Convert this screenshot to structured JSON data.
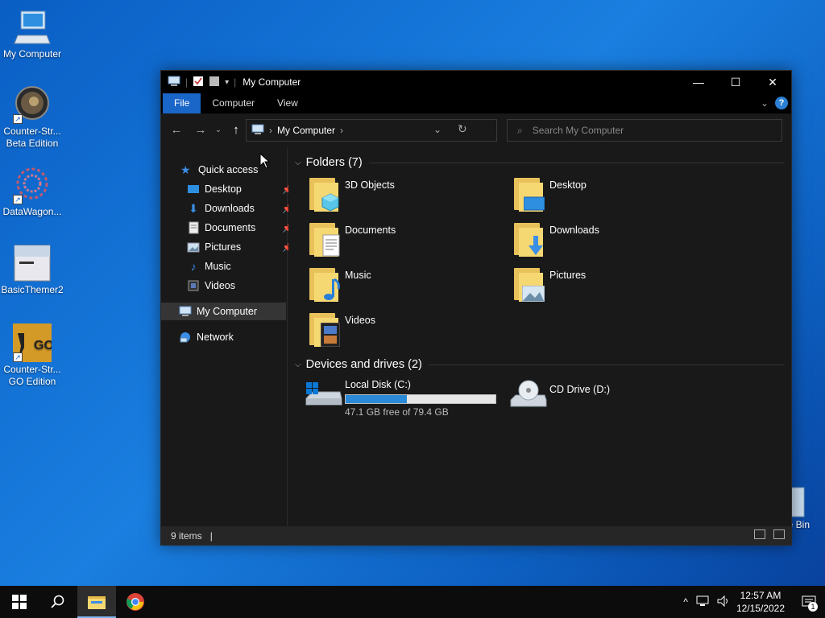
{
  "desktop": {
    "icons": [
      {
        "label": "My Computer",
        "icon": "computer-icon"
      },
      {
        "label": "Counter-Str... Beta Edition",
        "line1": "Counter-Str...",
        "line2": "Beta Edition",
        "icon": "cs-beta-icon"
      },
      {
        "label": "DataWagon...",
        "icon": "datawagon-icon"
      },
      {
        "label": "BasicThemer2",
        "icon": "window-icon"
      },
      {
        "label": "Counter-Str... GO Edition",
        "line1": "Counter-Str...",
        "line2": "GO Edition",
        "icon": "csgo-icon"
      },
      {
        "label": "e Bin",
        "icon": "recycle-bin-icon"
      }
    ]
  },
  "window": {
    "title": "My Computer",
    "ribbon_tabs": [
      "File",
      "Computer",
      "View"
    ],
    "address": {
      "root": "My Computer"
    },
    "search_placeholder": "Search My Computer",
    "sidebar": {
      "quick_access": "Quick access",
      "items": [
        {
          "label": "Desktop",
          "pinned": true
        },
        {
          "label": "Downloads",
          "pinned": true
        },
        {
          "label": "Documents",
          "pinned": true
        },
        {
          "label": "Pictures",
          "pinned": true
        },
        {
          "label": "Music",
          "pinned": false
        },
        {
          "label": "Videos",
          "pinned": false
        }
      ],
      "my_computer": "My Computer",
      "network": "Network"
    },
    "folders_header": "Folders (7)",
    "folders": [
      "3D Objects",
      "Desktop",
      "Documents",
      "Downloads",
      "Music",
      "Pictures",
      "Videos"
    ],
    "drives_header": "Devices and drives (2)",
    "drives": [
      {
        "name": "Local Disk (C:)",
        "free_text": "47.1 GB free of 79.4 GB",
        "used_fraction": 0.407
      },
      {
        "name": "CD Drive (D:)"
      }
    ],
    "status": {
      "items": "9 items"
    }
  },
  "taskbar": {
    "time": "12:57 AM",
    "date": "12/15/2022",
    "notification_count": "1"
  },
  "colors": {
    "accent": "#1a65c8",
    "window_bg": "#191919",
    "desktop": "#1a7fe0"
  }
}
